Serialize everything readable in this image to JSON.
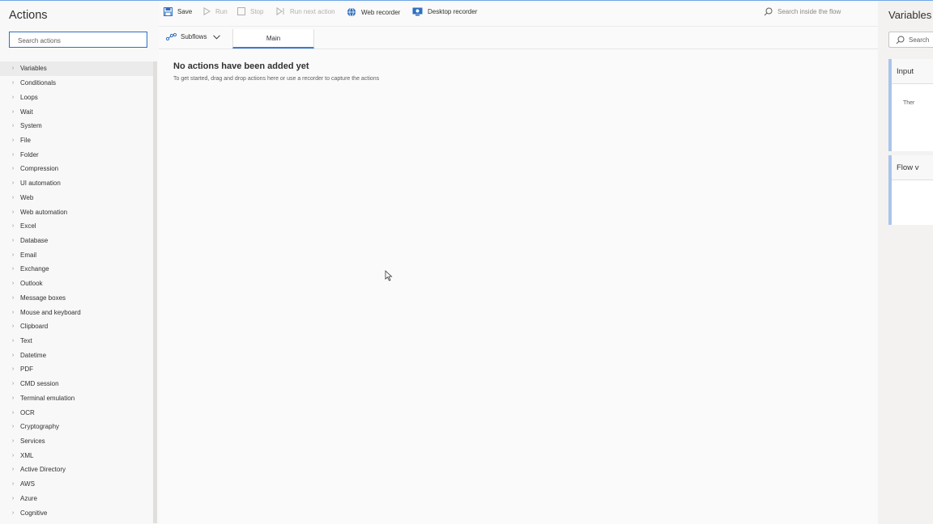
{
  "actions_pane": {
    "title": "Actions",
    "search_placeholder": "Search actions",
    "items": [
      "Variables",
      "Conditionals",
      "Loops",
      "Wait",
      "System",
      "File",
      "Folder",
      "Compression",
      "UI automation",
      "Web",
      "Web automation",
      "Excel",
      "Database",
      "Email",
      "Exchange",
      "Outlook",
      "Message boxes",
      "Mouse and keyboard",
      "Clipboard",
      "Text",
      "Datetime",
      "PDF",
      "CMD session",
      "Terminal emulation",
      "OCR",
      "Cryptography",
      "Services",
      "XML",
      "Active Directory",
      "AWS",
      "Azure",
      "Cognitive"
    ]
  },
  "toolbar": {
    "save": "Save",
    "run": "Run",
    "stop": "Stop",
    "run_next": "Run next action",
    "web_recorder": "Web recorder",
    "desktop_recorder": "Desktop recorder",
    "search_flow": "Search inside the flow"
  },
  "tabs": {
    "subflows": "Subflows",
    "main": "Main"
  },
  "canvas": {
    "empty_title": "No actions have been added yet",
    "empty_subtitle": "To get started, drag and drop actions here or use a recorder to capture the actions"
  },
  "variables_pane": {
    "title": "Variables",
    "search_placeholder": "Search",
    "input_panel_title": "Input",
    "input_panel_text": "Ther",
    "flow_panel_title": "Flow v"
  },
  "colors": {
    "accent": "#3a7bd5",
    "panel_accent": "#a9c5ea"
  }
}
